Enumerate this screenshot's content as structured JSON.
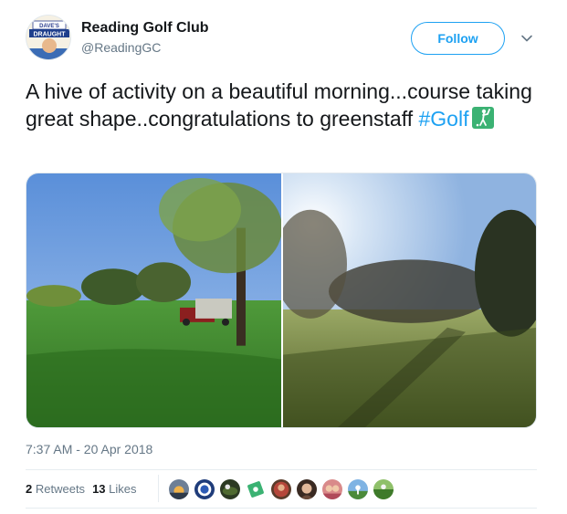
{
  "account": {
    "name": "Reading Golf Club",
    "handle": "@ReadingGC",
    "avatar_icon": "daves-draught-avatar",
    "avatar_text_top": "DAVE'S",
    "avatar_text_bottom": "DRAUGHT"
  },
  "actions": {
    "follow_label": "Follow",
    "menu_icon": "chevron-down-icon"
  },
  "tweet": {
    "text": "A hive of activity on a beautiful morning...course taking great shape..congratulations to greenstaff ",
    "hashtag": "#Golf",
    "emoji_icon": "golfer-emoji-icon"
  },
  "media": {
    "photos": [
      "golf-course-photo-with-cart",
      "golf-course-photo-sunrise"
    ]
  },
  "meta": {
    "timestamp": "7:37 AM - 20 Apr 2018"
  },
  "stats": {
    "retweets_count": "2",
    "retweets_label": "Retweets",
    "likes_count": "13",
    "likes_label": "Likes"
  },
  "likers": [
    {
      "icon": "liker-avatar-1"
    },
    {
      "icon": "liker-avatar-2"
    },
    {
      "icon": "liker-avatar-3"
    },
    {
      "icon": "liker-avatar-4"
    },
    {
      "icon": "liker-avatar-5"
    },
    {
      "icon": "liker-avatar-6"
    },
    {
      "icon": "liker-avatar-7"
    },
    {
      "icon": "liker-avatar-8"
    },
    {
      "icon": "liker-avatar-9"
    }
  ],
  "colors": {
    "accent": "#1da1f2",
    "text": "#14171a",
    "secondary": "#657786"
  }
}
